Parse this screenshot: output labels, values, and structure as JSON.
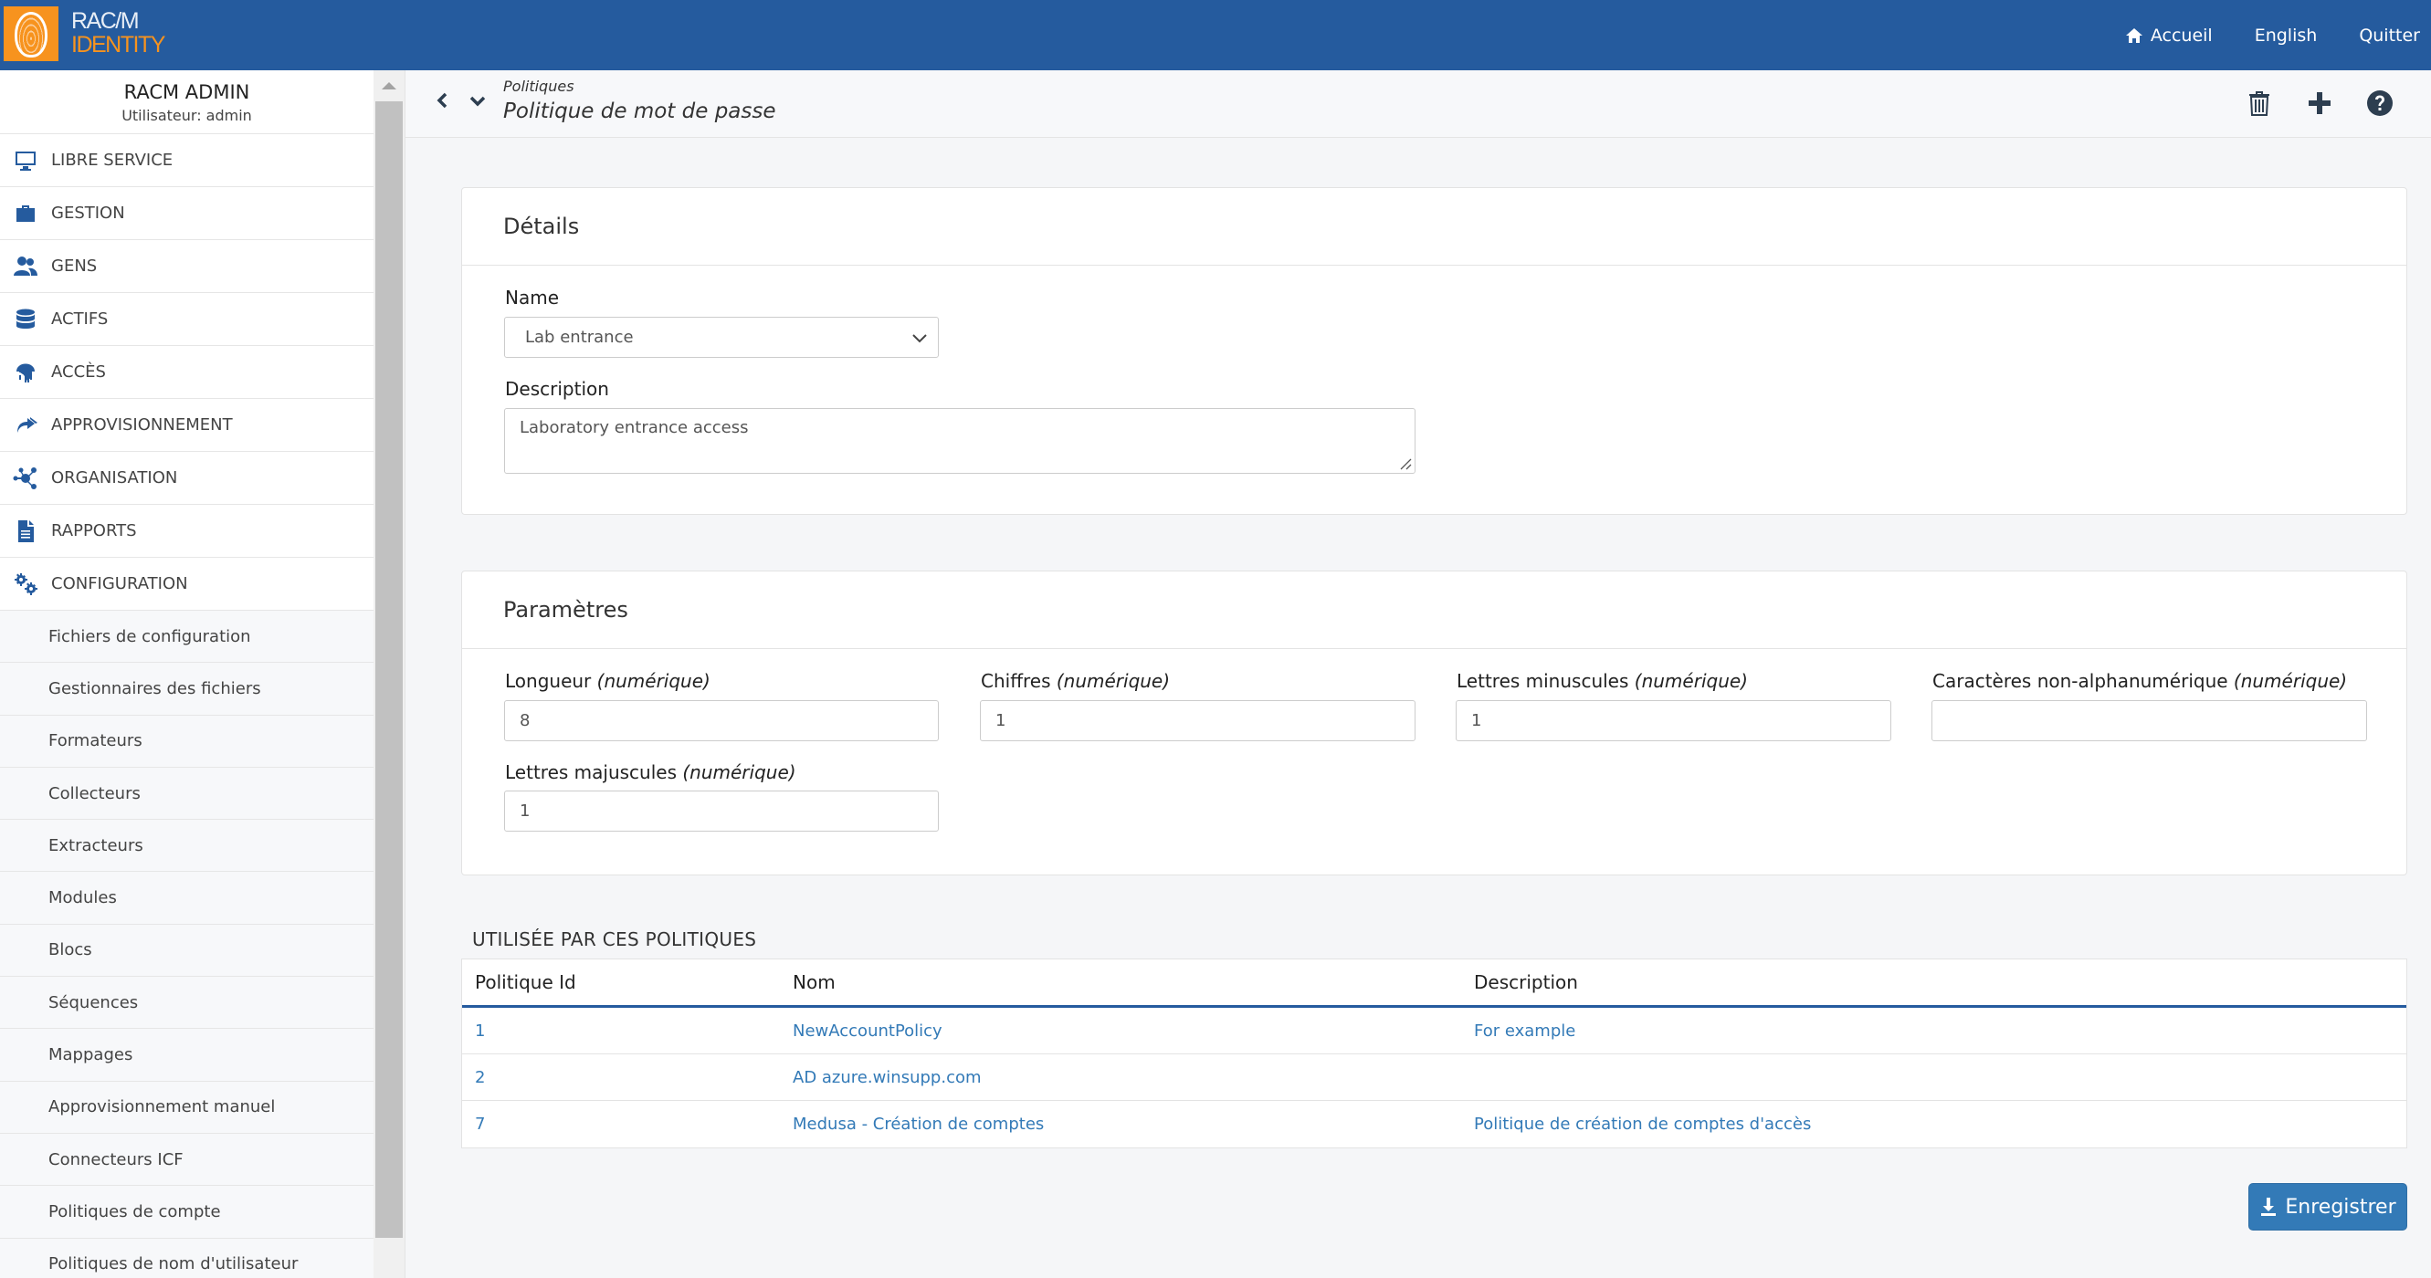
{
  "app": {
    "logo_line1": "RAC/M",
    "logo_line2": "IDENTITY"
  },
  "topnav": {
    "home": "Accueil",
    "language": "English",
    "quit": "Quitter"
  },
  "user": {
    "name": "RACM ADMIN",
    "login": "Utilisateur: admin"
  },
  "sidebar": {
    "items": [
      {
        "label": "LIBRE SERVICE",
        "icon": "desktop-icon"
      },
      {
        "label": "GESTION",
        "icon": "toolbox-icon"
      },
      {
        "label": "GENS",
        "icon": "users-icon"
      },
      {
        "label": "ACTIFS",
        "icon": "database-icon"
      },
      {
        "label": "ACCÈS",
        "icon": "fingerprint-icon"
      },
      {
        "label": "APPROVISIONNEMENT",
        "icon": "share-icon"
      },
      {
        "label": "ORGANISATION",
        "icon": "network-icon"
      },
      {
        "label": "RAPPORTS",
        "icon": "file-icon"
      },
      {
        "label": "CONFIGURATION",
        "icon": "cogs-icon"
      }
    ],
    "subitems": [
      "Fichiers de configuration",
      "Gestionnaires des fichiers",
      "Formateurs",
      "Collecteurs",
      "Extracteurs",
      "Modules",
      "Blocs",
      "Séquences",
      "Mappages",
      "Approvisionnement manuel",
      "Connecteurs ICF",
      "Politiques de compte",
      "Politiques de nom d'utilisateur"
    ]
  },
  "page": {
    "breadcrumb": "Politiques",
    "title": "Politique de mot de passe"
  },
  "details": {
    "title": "Détails",
    "name_label": "Name",
    "name_value": "Lab entrance",
    "description_label": "Description",
    "description_value": "Laboratory entrance access"
  },
  "params": {
    "title": "Paramètres",
    "numeric_hint": "(numérique)",
    "fields": [
      {
        "label": "Longueur",
        "value": "8"
      },
      {
        "label": "Chiffres",
        "value": "1"
      },
      {
        "label": "Lettres minuscules",
        "value": "1"
      },
      {
        "label": "Caractères non-alphanumérique",
        "value": ""
      },
      {
        "label": "Lettres majuscules",
        "value": "1"
      }
    ]
  },
  "usedby": {
    "title": "UTILISÉE PAR CES POLITIQUES",
    "columns": [
      "Politique Id",
      "Nom",
      "Description"
    ],
    "rows": [
      {
        "id": "1",
        "name": "NewAccountPolicy",
        "description": "For example"
      },
      {
        "id": "2",
        "name": "AD azure.winsupp.com",
        "description": ""
      },
      {
        "id": "7",
        "name": "Medusa - Création de comptes",
        "description": "Politique de création de comptes d'accès"
      }
    ]
  },
  "save_label": "Enregistrer",
  "colors": {
    "brand_blue": "#255b9e",
    "brand_orange": "#f7931e",
    "link": "#337ab7"
  }
}
